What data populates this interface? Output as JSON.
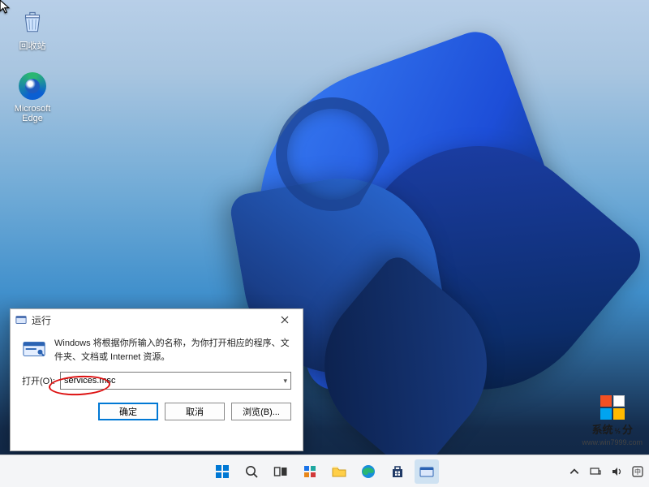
{
  "desktop": {
    "icons": {
      "recycle_bin": "回收站",
      "edge": "Microsoft\nEdge"
    }
  },
  "run": {
    "title": "运行",
    "description": "Windows 将根据你所输入的名称，为你打开相应的程序、文件夹、文档或 Internet 资源。",
    "open_label": "打开(O):",
    "open_value": "services.msc",
    "ok": "确定",
    "cancel": "取消",
    "browse": "浏览(B)..."
  },
  "watermark": {
    "brand_a": "系统",
    "brand_b": "分",
    "half_glyph": "½",
    "url": "www.win7999.com"
  }
}
